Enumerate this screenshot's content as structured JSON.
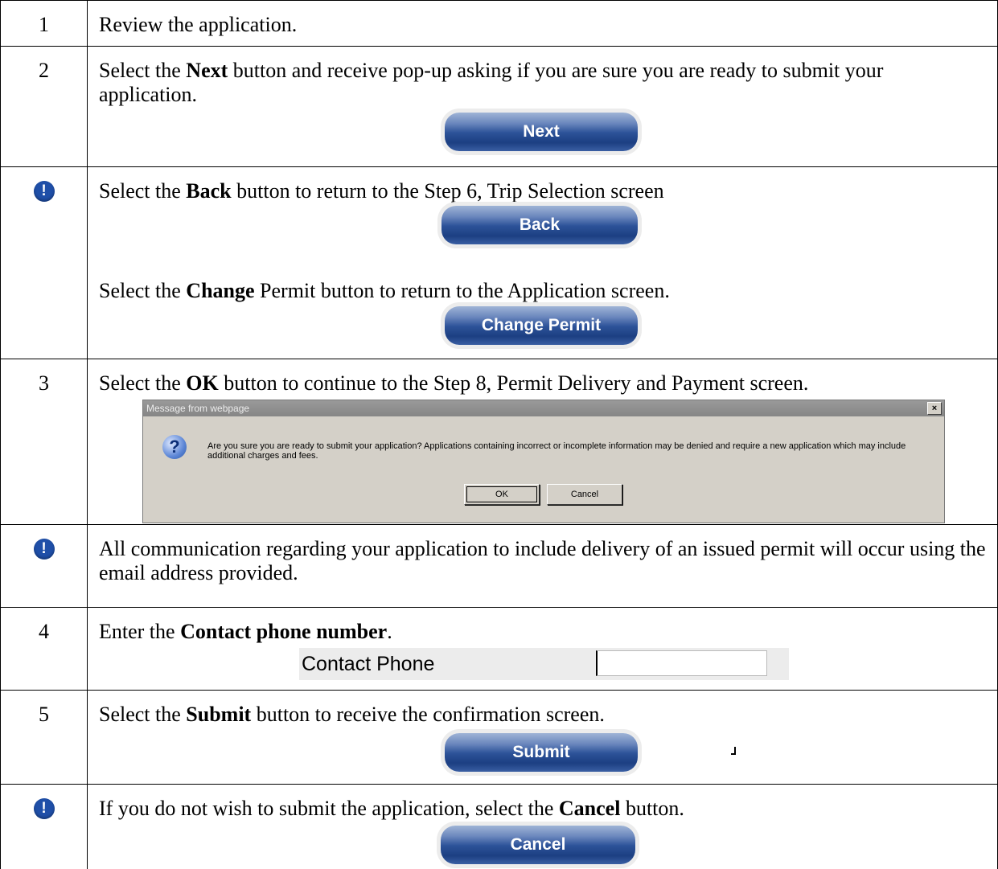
{
  "rows": [
    {
      "num": "1",
      "text": "Review the application."
    },
    {
      "num": "2",
      "pre": "Select the ",
      "bold": "Next",
      "post": " button and receive pop-up asking if you are sure you are ready to submit your application.",
      "button": "Next"
    },
    {
      "icon": "exclamation-icon",
      "a": {
        "pre": "Select the ",
        "bold": "Back",
        "post": " button to return to the Step 6, Trip Selection screen",
        "button": "Back"
      },
      "b": {
        "pre": "Select the ",
        "bold": "Change",
        "post": " Permit button to return to the Application screen.",
        "button": "Change Permit"
      }
    },
    {
      "num": "3",
      "pre": "Select the ",
      "bold": "OK",
      "post": " button to continue to the Step 8, Permit Delivery and Payment screen.",
      "dialog": {
        "title": "Message from webpage",
        "close": "×",
        "icon": "question-icon",
        "message": "Are you sure you are ready to submit your application? Applications containing incorrect or incomplete information may be denied and require a new application which may include additional charges and fees.",
        "ok": "OK",
        "cancel": "Cancel"
      }
    },
    {
      "icon": "exclamation-icon",
      "text": "All communication regarding your application to include delivery of an issued permit will occur using the email address provided."
    },
    {
      "num": "4",
      "pre": "Enter the ",
      "bold": "Contact phone number",
      "post": ".",
      "field_label": "Contact Phone",
      "field_value": ""
    },
    {
      "num": "5",
      "pre": "Select the ",
      "bold": "Submit",
      "post": " button to receive the confirmation screen.",
      "button": "Submit"
    },
    {
      "icon": "exclamation-icon",
      "pre": "If you do not wish to submit the application, select the ",
      "bold": "Cancel",
      "post": " button.",
      "button": "Cancel"
    }
  ]
}
